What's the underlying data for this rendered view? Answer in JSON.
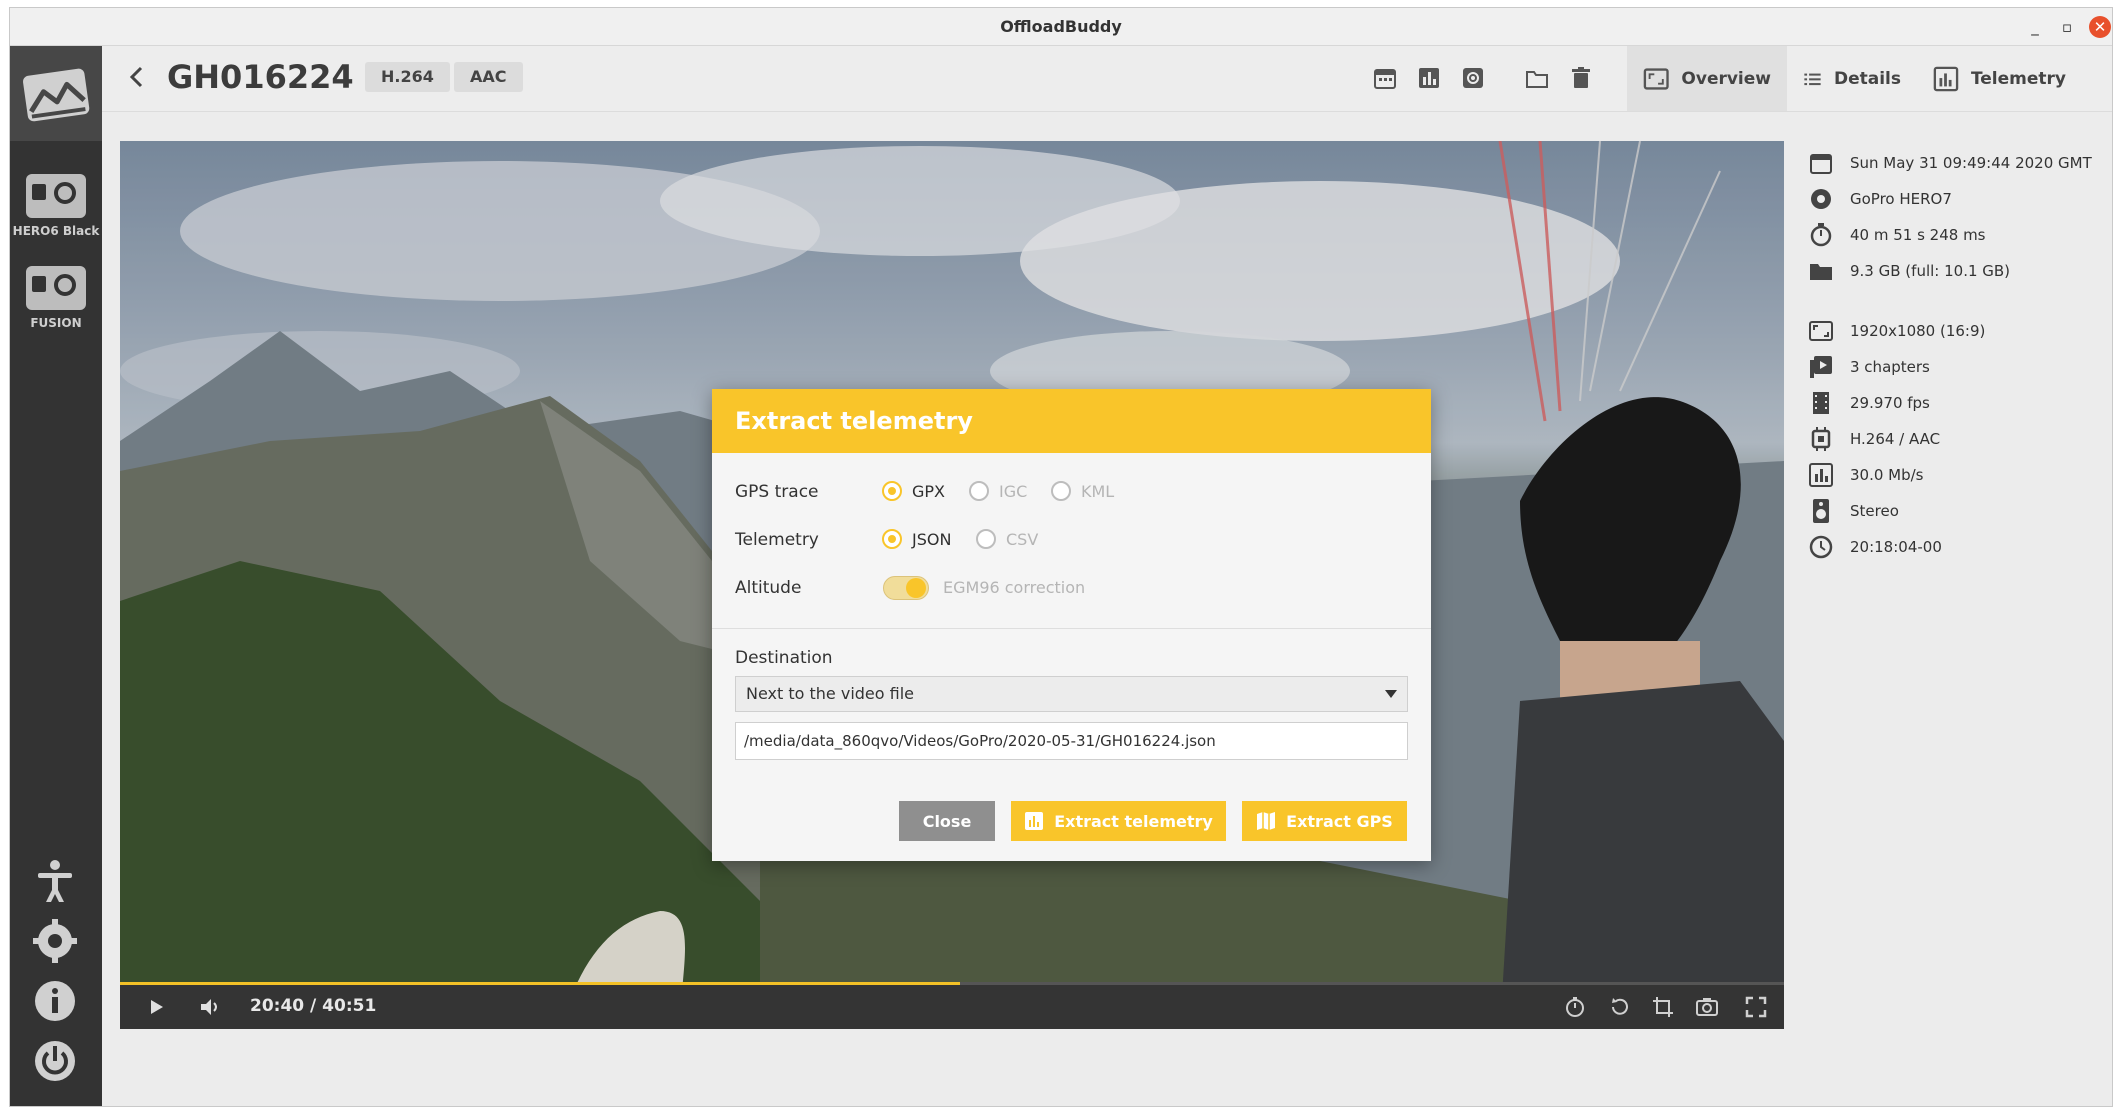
{
  "window": {
    "title": "OffloadBuddy",
    "controls": {
      "minimize": "_",
      "maximize": "▫",
      "close": "✕"
    }
  },
  "sidebar": {
    "cameras": [
      {
        "label": "HERO6 Black",
        "icon": "camera-icon"
      },
      {
        "label": "FUSION",
        "icon": "camera-icon"
      }
    ],
    "bottom_icons": [
      "accessibility-icon",
      "settings-icon",
      "info-icon",
      "power-icon"
    ]
  },
  "header": {
    "filename": "GH016224",
    "codecs": [
      "H.264",
      "AAC"
    ],
    "tabs": [
      {
        "label": "Overview",
        "icon": "overview-icon",
        "active": true
      },
      {
        "label": "Details",
        "icon": "list-icon",
        "active": false
      },
      {
        "label": "Telemetry",
        "icon": "chart-icon",
        "active": false
      }
    ]
  },
  "info": [
    {
      "icon": "calendar-icon",
      "text": "Sun May 31 09:49:44 2020 GMT"
    },
    {
      "icon": "camera-aperture-icon",
      "text": "GoPro HERO7"
    },
    {
      "icon": "stopwatch-icon",
      "text": "40 m 51 s 248 ms"
    },
    {
      "icon": "folder-icon",
      "text": "9.3 GB   (full: 10.1 GB)"
    },
    {
      "icon": "aspect-ratio-icon",
      "text": "1920x1080   (16:9)"
    },
    {
      "icon": "chapters-icon",
      "text": "3 chapters"
    },
    {
      "icon": "film-icon",
      "text": "29.970 fps"
    },
    {
      "icon": "chip-icon",
      "text": "H.264 / AAC"
    },
    {
      "icon": "bitrate-icon",
      "text": "30.0 Mb/s"
    },
    {
      "icon": "speaker-icon",
      "text": "Stereo"
    },
    {
      "icon": "timecode-icon",
      "text": "20:18:04-00"
    }
  ],
  "player": {
    "time": "20:40 / 40:51",
    "progress": 0.505
  },
  "dialog": {
    "title": "Extract telemetry",
    "gps_label": "GPS trace",
    "gps_options": [
      {
        "label": "GPX",
        "selected": true,
        "enabled": true
      },
      {
        "label": "IGC",
        "selected": false,
        "enabled": false
      },
      {
        "label": "KML",
        "selected": false,
        "enabled": false
      }
    ],
    "telemetry_label": "Telemetry",
    "telemetry_options": [
      {
        "label": "JSON",
        "selected": true,
        "enabled": true
      },
      {
        "label": "CSV",
        "selected": false,
        "enabled": false
      }
    ],
    "altitude_label": "Altitude",
    "altitude_toggle_label": "EGM96 correction",
    "altitude_toggle_on": true,
    "destination_label": "Destination",
    "destination_value": "Next to the video file",
    "path_value": "/media/data_860qvo/Videos/GoPro/2020-05-31/GH016224.json",
    "close_label": "Close",
    "extract_telemetry_label": "Extract telemetry",
    "extract_gps_label": "Extract GPS"
  },
  "colors": {
    "accent": "#f9c52a",
    "sidebar": "#333333",
    "close": "#e8502c"
  }
}
